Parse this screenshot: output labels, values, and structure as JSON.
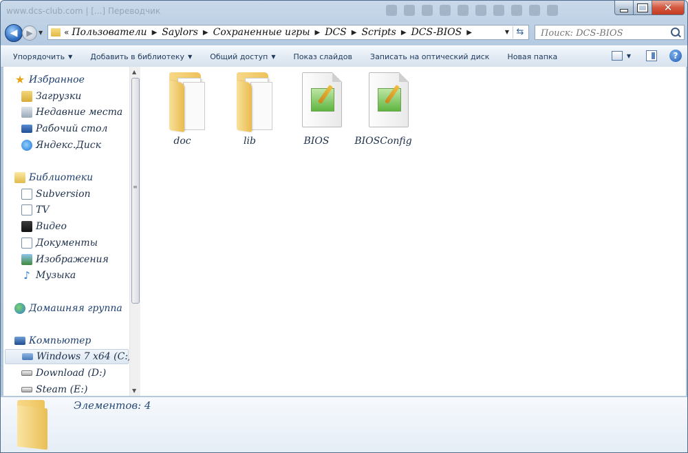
{
  "window": {
    "title": "",
    "ghost_title": "www.dcs-club.com | [...] Переводчик"
  },
  "address": {
    "segments": [
      "Пользователи",
      "Saylors",
      "Сохраненные игры",
      "DCS",
      "Scripts",
      "DCS-BIOS"
    ]
  },
  "search": {
    "placeholder": "Поиск: DCS-BIOS"
  },
  "toolbar": {
    "organize": "Упорядочить",
    "add_to_library": "Добавить в библиотеку",
    "share": "Общий доступ",
    "slideshow": "Показ слайдов",
    "burn": "Записать на оптический диск",
    "new_folder": "Новая папка"
  },
  "nav": {
    "favorites": {
      "label": "Избранное",
      "items": [
        {
          "label": "Загрузки",
          "icon": "downloads-icon"
        },
        {
          "label": "Недавние места",
          "icon": "recent-places-icon"
        },
        {
          "label": "Рабочий стол",
          "icon": "desktop-icon"
        },
        {
          "label": "Яндекс.Диск",
          "icon": "yandex-disk-icon"
        }
      ]
    },
    "libraries": {
      "label": "Библиотеки",
      "items": [
        {
          "label": "Subversion",
          "icon": "document-icon"
        },
        {
          "label": "TV",
          "icon": "document-icon"
        },
        {
          "label": "Видео",
          "icon": "video-icon"
        },
        {
          "label": "Документы",
          "icon": "documents-icon"
        },
        {
          "label": "Изображения",
          "icon": "pictures-icon"
        },
        {
          "label": "Музыка",
          "icon": "music-icon"
        }
      ]
    },
    "homegroup": {
      "label": "Домашняя группа"
    },
    "computer": {
      "label": "Компьютер",
      "items": [
        {
          "label": "Windows 7 x64 (C:)",
          "icon": "windows-drive-icon",
          "selected": true
        },
        {
          "label": "Download (D:)",
          "icon": "drive-icon"
        },
        {
          "label": "Steam (E:)",
          "icon": "drive-icon"
        }
      ]
    }
  },
  "files": [
    {
      "name": "doc",
      "type": "folder"
    },
    {
      "name": "lib",
      "type": "folder"
    },
    {
      "name": "BIOS",
      "type": "script"
    },
    {
      "name": "BIOSConfig",
      "type": "script"
    }
  ],
  "details": {
    "item_count": "Элементов: 4"
  }
}
